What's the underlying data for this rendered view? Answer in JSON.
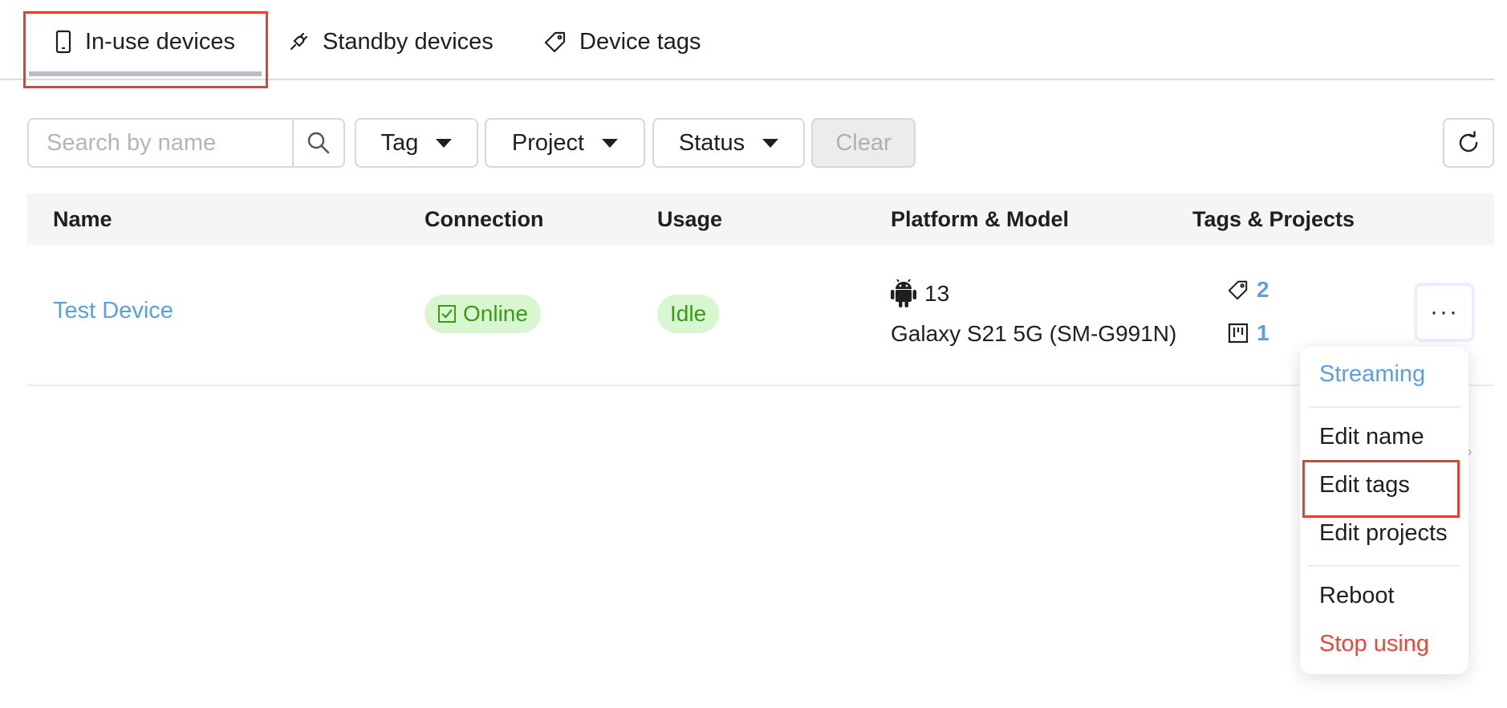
{
  "tabs": [
    {
      "label": "In-use devices",
      "icon": "phone-icon",
      "active": true
    },
    {
      "label": "Standby devices",
      "icon": "plug-icon",
      "active": false
    },
    {
      "label": "Device tags",
      "icon": "tag-icon",
      "active": false
    }
  ],
  "filters": {
    "search_placeholder": "Search by name",
    "tag_label": "Tag",
    "project_label": "Project",
    "status_label": "Status",
    "clear_label": "Clear"
  },
  "table": {
    "columns": [
      "Name",
      "Connection",
      "Usage",
      "Platform & Model",
      "Tags & Projects"
    ],
    "rows": [
      {
        "name": "Test Device",
        "connection": "Online",
        "usage": "Idle",
        "platform_version": "13",
        "model": "Galaxy S21 5G (SM-G991N)",
        "tags_count": "2",
        "projects_count": "1"
      }
    ]
  },
  "more_label": "···",
  "menu": {
    "items": [
      {
        "label": "Streaming",
        "color": "#5aa0e0"
      },
      {
        "label": "Edit name",
        "color": "#1f1f1f"
      },
      {
        "label": "Edit tags",
        "color": "#1f1f1f"
      },
      {
        "label": "Edit projects",
        "color": "#1f1f1f"
      },
      {
        "label": "Reboot",
        "color": "#1f1f1f"
      },
      {
        "label": "Stop using",
        "color": "#e8473c"
      }
    ]
  },
  "colors": {
    "accent": "#5aa0e0",
    "highlight": "#e2412b",
    "online_bg": "#d8f6cf",
    "online_text": "#3a9a1a",
    "danger": "#e8473c"
  }
}
